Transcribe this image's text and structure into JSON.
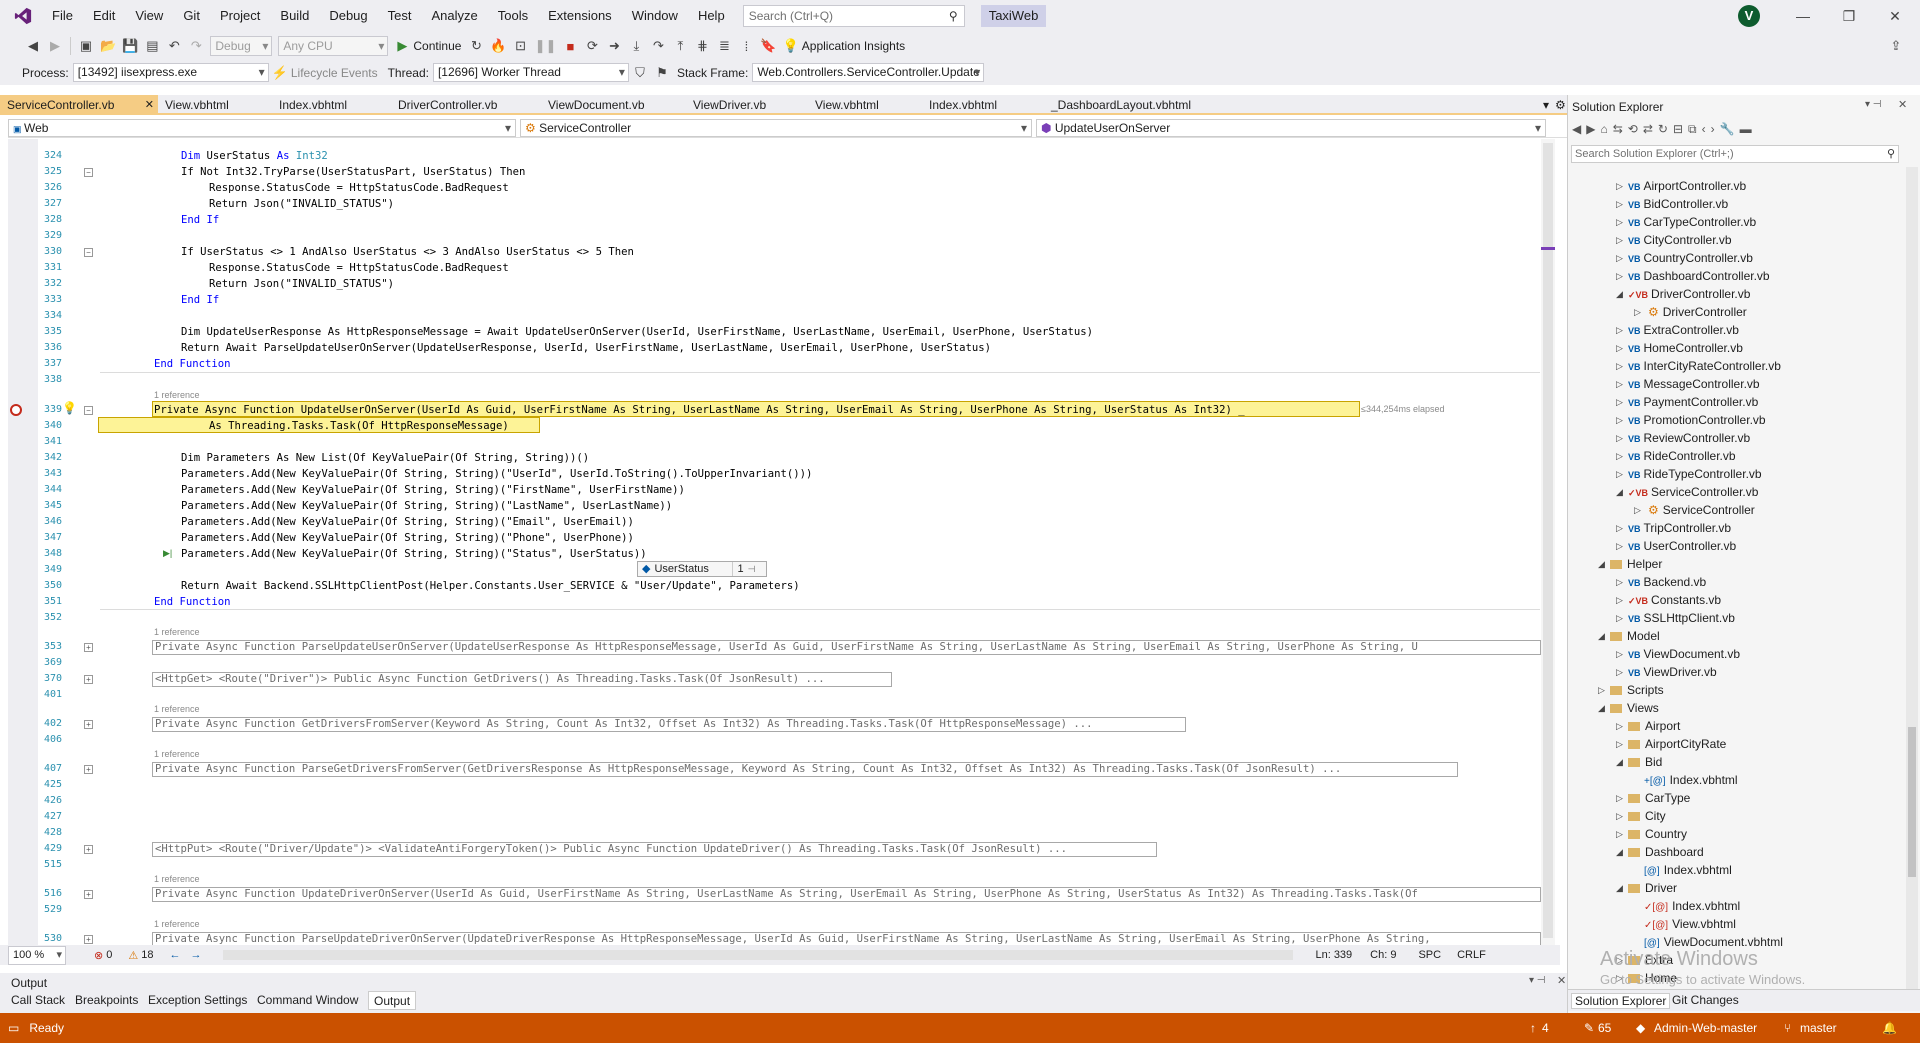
{
  "menu": [
    "File",
    "Edit",
    "View",
    "Git",
    "Project",
    "Build",
    "Debug",
    "Test",
    "Analyze",
    "Tools",
    "Extensions",
    "Window",
    "Help"
  ],
  "search": {
    "placeholder": "Search (Ctrl+Q)"
  },
  "app_name": "TaxiWeb",
  "avatar": "V",
  "toolbar1": {
    "config": "Debug",
    "platform": "Any CPU",
    "continue": "Continue",
    "app_insights": "Application Insights"
  },
  "toolbar2": {
    "process_label": "Process:",
    "process": "[13492] iisexpress.exe",
    "lifecycle": "Lifecycle Events",
    "thread_label": "Thread:",
    "thread": "[12696] Worker Thread",
    "stackframe_label": "Stack Frame:",
    "stackframe": "Web.Controllers.ServiceController.Update"
  },
  "tabs": [
    "ServiceController.vb",
    "View.vbhtml",
    "Index.vbhtml",
    "DriverController.vb",
    "ViewDocument.vb",
    "ViewDriver.vb",
    "View.vbhtml",
    "Index.vbhtml",
    "_DashboardLayout.vbhtml"
  ],
  "nav": {
    "project": "Web",
    "class": "ServiceController",
    "member": "UpdateUserOnServer"
  },
  "lines": {
    "l324": {
      "n": "324"
    },
    "l325": {
      "n": "325"
    },
    "l326": {
      "n": "326"
    },
    "l327": {
      "n": "327"
    },
    "l328": {
      "n": "328"
    },
    "l329": {
      "n": "329"
    },
    "l330": {
      "n": "330"
    },
    "l331": {
      "n": "331"
    },
    "l332": {
      "n": "332"
    },
    "l333": {
      "n": "333"
    },
    "l334": {
      "n": "334"
    },
    "l335": {
      "n": "335"
    },
    "l336": {
      "n": "336"
    },
    "l337": {
      "n": "337"
    },
    "l338": {
      "n": "338"
    },
    "l339": {
      "n": "339"
    },
    "l340": {
      "n": "340"
    },
    "l341": {
      "n": "341"
    },
    "l342": {
      "n": "342"
    },
    "l343": {
      "n": "343"
    },
    "l344": {
      "n": "344"
    },
    "l345": {
      "n": "345"
    },
    "l346": {
      "n": "346"
    },
    "l347": {
      "n": "347"
    },
    "l348": {
      "n": "348"
    },
    "l349": {
      "n": "349"
    },
    "l350": {
      "n": "350"
    },
    "l351": {
      "n": "351"
    },
    "l352": {
      "n": "352"
    },
    "l353": {
      "n": "353"
    },
    "l369": {
      "n": "369"
    },
    "l370": {
      "n": "370"
    },
    "l401": {
      "n": "401"
    },
    "l402": {
      "n": "402"
    },
    "l406": {
      "n": "406"
    },
    "l407": {
      "n": "407"
    },
    "l425": {
      "n": "425"
    },
    "l426": {
      "n": "426"
    },
    "l427": {
      "n": "427"
    },
    "l428": {
      "n": "428"
    },
    "l429": {
      "n": "429"
    },
    "l515": {
      "n": "515"
    },
    "l516": {
      "n": "516"
    },
    "l529": {
      "n": "529"
    },
    "l530": {
      "n": "530"
    }
  },
  "code": {
    "c324a": "Dim UserStatus As ",
    "c324b": "Int32",
    "c325": "If Not Int32.TryParse(UserStatusPart, UserStatus) Then",
    "c326": "Response.StatusCode = HttpStatusCode.BadRequest",
    "c327": "Return Json(\"INVALID_STATUS\")",
    "c328": "End If",
    "c330": "If UserStatus <> 1 AndAlso UserStatus <> 3 AndAlso UserStatus <> 5 Then",
    "c331": "Response.StatusCode = HttpStatusCode.BadRequest",
    "c332": "Return Json(\"INVALID_STATUS\")",
    "c333": "End If",
    "c335": "Dim UpdateUserResponse As HttpResponseMessage = Await UpdateUserOnServer(UserId, UserFirstName, UserLastName, UserEmail, UserPhone, UserStatus)",
    "c336": "Return Await ParseUpdateUserOnServer(UpdateUserResponse, UserId, UserFirstName, UserLastName, UserEmail, UserPhone, UserStatus)",
    "c337": "End Function",
    "ref1": "1 reference",
    "c339": "Private Async Function UpdateUserOnServer(UserId As Guid, UserFirstName As String, UserLastName As String, UserEmail As String, UserPhone As String, UserStatus As Int32) _",
    "elapsed": "≤344,254ms elapsed",
    "c340": "As Threading.Tasks.Task(Of HttpResponseMessage)",
    "c342": "Dim Parameters As New List(Of KeyValuePair(Of String, String))()",
    "c343": "Parameters.Add(New KeyValuePair(Of String, String)(\"UserId\", UserId.ToString().ToUpperInvariant()))",
    "c344": "Parameters.Add(New KeyValuePair(Of String, String)(\"FirstName\", UserFirstName))",
    "c345": "Parameters.Add(New KeyValuePair(Of String, String)(\"LastName\", UserLastName))",
    "c346": "Parameters.Add(New KeyValuePair(Of String, String)(\"Email\", UserEmail))",
    "c347": "Parameters.Add(New KeyValuePair(Of String, String)(\"Phone\", UserPhone))",
    "c348": "Parameters.Add(New KeyValuePair(Of String, String)(\"Status\", UserStatus))",
    "tip_name": "UserStatus",
    "tip_val": "1",
    "c350": "Return Await Backend.SSLHttpClientPost(Helper.Constants.User_SERVICE & \"User/Update\", Parameters)",
    "c351": "End Function",
    "ref353": "1 reference",
    "c353": "Private Async Function ParseUpdateUserOnServer(UpdateUserResponse As HttpResponseMessage, UserId As Guid, UserFirstName As String, UserLastName As String, UserEmail As String, UserPhone As String, U",
    "c370": "<HttpGet> <Route(\"Driver\")> Public Async Function GetDrivers() As Threading.Tasks.Task(Of JsonResult) ...",
    "ref402": "1 reference",
    "c402": "Private Async Function GetDriversFromServer(Keyword As String, Count As Int32, Offset As Int32) As Threading.Tasks.Task(Of HttpResponseMessage) ...",
    "ref407": "1 reference",
    "c407": "Private Async Function ParseGetDriversFromServer(GetDriversResponse As HttpResponseMessage, Keyword As String, Count As Int32, Offset As Int32) As Threading.Tasks.Task(Of JsonResult) ...",
    "c429": "<HttpPut> <Route(\"Driver/Update\")> <ValidateAntiForgeryToken()> Public Async Function UpdateDriver() As Threading.Tasks.Task(Of JsonResult) ...",
    "ref516": "1 reference",
    "c516": "Private Async Function UpdateDriverOnServer(UserId As Guid, UserFirstName As String, UserLastName As String, UserEmail As String, UserPhone As String, UserStatus As Int32) As Threading.Tasks.Task(Of",
    "ref530": "1 reference",
    "c530": "Private Async Function ParseUpdateDriverOnServer(UpdateDriverResponse As HttpResponseMessage, UserId As Guid, UserFirstName As String, UserLastName As String, UserEmail As String, UserPhone As String,"
  },
  "editor_status": {
    "zoom": "100 %",
    "errors": "0",
    "warnings": "18",
    "ln": "Ln: 339",
    "ch": "Ch: 9",
    "spc": "SPC",
    "crlf": "CRLF"
  },
  "output": {
    "title": "Output",
    "tabs": [
      "Call Stack",
      "Breakpoints",
      "Exception Settings",
      "Command Window",
      "Output"
    ]
  },
  "solution_explorer": {
    "title": "Solution Explorer",
    "search_placeholder": "Search Solution Explorer (Ctrl+;)",
    "items": [
      "AirportController.vb",
      "BidController.vb",
      "CarTypeController.vb",
      "CityController.vb",
      "CountryController.vb",
      "DashboardController.vb",
      "DriverController.vb",
      "DriverController",
      "ExtraController.vb",
      "HomeController.vb",
      "InterCityRateController.vb",
      "MessageController.vb",
      "PaymentController.vb",
      "PromotionController.vb",
      "ReviewController.vb",
      "RideController.vb",
      "RideTypeController.vb",
      "ServiceController.vb",
      "ServiceController",
      "TripController.vb",
      "UserController.vb",
      "Helper",
      "Backend.vb",
      "Constants.vb",
      "SSLHttpClient.vb",
      "Model",
      "ViewDocument.vb",
      "ViewDriver.vb",
      "Scripts",
      "Views",
      "Airport",
      "AirportCityRate",
      "Bid",
      "Index.vbhtml",
      "CarType",
      "City",
      "Country",
      "Dashboard",
      "Index.vbhtml",
      "Driver",
      "Index.vbhtml",
      "View.vbhtml",
      "ViewDocument.vbhtml",
      "Extra",
      "Home"
    ],
    "bottom_tabs": [
      "Solution Explorer",
      "Git Changes"
    ]
  },
  "watermark": {
    "line1": "Activate Windows",
    "line2": "Go to Settings to activate Windows."
  },
  "statusbar": {
    "ready": "Ready",
    "up": "4",
    "edits": "65",
    "repo": "Admin-Web-master",
    "branch": "master"
  },
  "colors": {
    "accent": "#68217a",
    "status": "#ca5100",
    "tab_active": "#f5cc84"
  }
}
